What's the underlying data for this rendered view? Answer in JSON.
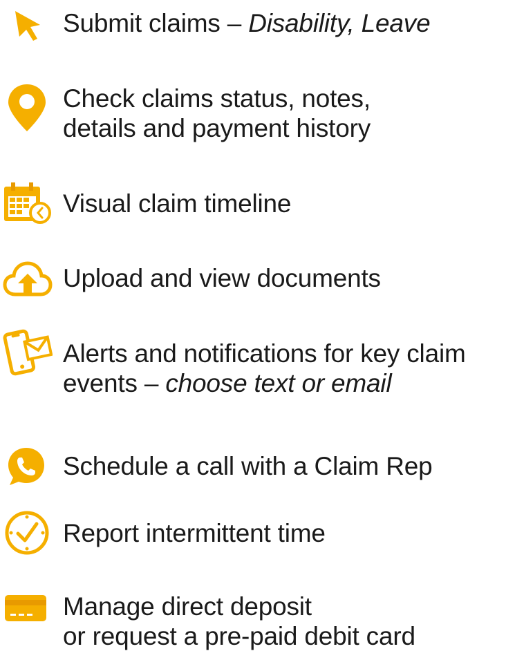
{
  "colors": {
    "accent": "#F5AF00",
    "accent_dark": "#E89A00",
    "text": "#1A1A1A"
  },
  "features": [
    {
      "icon": "cursor-arrow-icon",
      "line1": "Submit claims – ",
      "line1_em": "Disability, Leave"
    },
    {
      "icon": "location-pin-icon",
      "line1": "Check claims status, notes,",
      "line2": "details and payment history"
    },
    {
      "icon": "calendar-clock-icon",
      "line1": "Visual claim timeline"
    },
    {
      "icon": "cloud-upload-icon",
      "line1": "Upload and view documents"
    },
    {
      "icon": "phone-message-icon",
      "line1": "Alerts and notifications for key claim",
      "line2": "events – ",
      "line2_em": "choose text or email"
    },
    {
      "icon": "phone-chat-icon",
      "line1": "Schedule a call with a Claim Rep"
    },
    {
      "icon": "clock-icon",
      "line1": "Report intermittent time"
    },
    {
      "icon": "credit-card-icon",
      "line1": "Manage direct deposit",
      "line2": "or request a pre-paid debit card"
    }
  ]
}
